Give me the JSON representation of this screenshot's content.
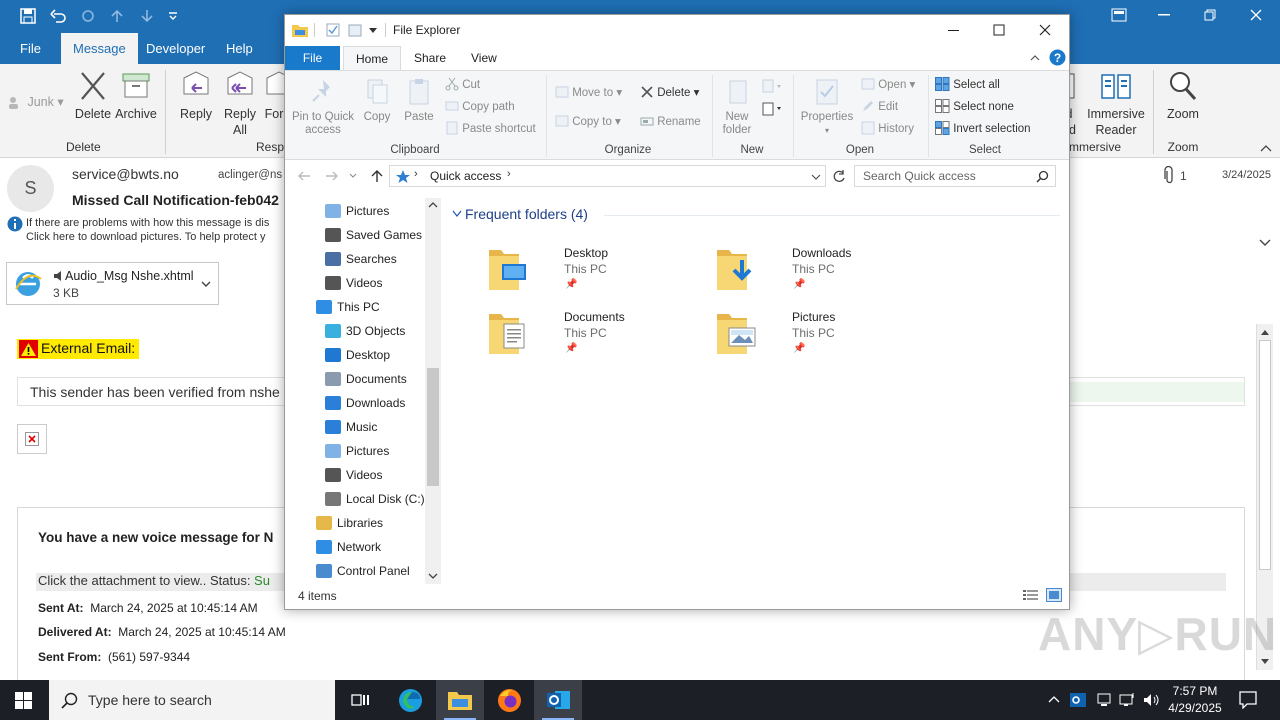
{
  "outlook": {
    "title_text": "",
    "tabs": [
      "File",
      "Message",
      "Developer",
      "Help"
    ],
    "ribbon": {
      "junk": "Junk",
      "delete": "Delete",
      "archive": "Archive",
      "group_delete": "Delete",
      "reply": "Reply",
      "reply_all_1": "Reply",
      "reply_all_2": "All",
      "forward": "For",
      "group_respond": "Resp",
      "read_aloud_1": "d",
      "read_aloud_2": "ud",
      "immersive_1": "Immersive",
      "immersive_2": "Reader",
      "group_immersive": "mmersive",
      "zoom": "Zoom",
      "group_zoom": "Zoom"
    },
    "message": {
      "avatar_letter": "S",
      "from": "service@bwts.no",
      "to": "aclinger@ns",
      "subject": "Missed Call Notification-feb042",
      "info_line1": "If there are problems with how this message is dis",
      "info_line2": "Click here to download pictures. To help protect y",
      "attachment_count": "1",
      "date": "3/24/2025",
      "attachment_name": "Audio_Msg Nshe.xhtml",
      "attachment_size": "3 KB",
      "external_label": "External Email:",
      "verified_text": "This sender has been verified from nshe",
      "voice_heading": "You have a new voice message for N",
      "click_line": "Click the attachment to view.. Status: ",
      "status_value": "Su",
      "sent_at_label": "Sent At:",
      "sent_at_value": "March 24, 2025 at 10:45:14 AM",
      "delivered_label": "Delivered At:",
      "delivered_value": "March 24, 2025 at 10:45:14 AM",
      "sent_from_label": "Sent From:",
      "sent_from_value": "(561) 597-9344"
    }
  },
  "explorer": {
    "title": "File Explorer",
    "tabs": [
      "File",
      "Home",
      "Share",
      "View"
    ],
    "ribbon": {
      "pin_1": "Pin to Quick",
      "pin_2": "access",
      "copy": "Copy",
      "paste": "Paste",
      "cut": "Cut",
      "copy_path": "Copy path",
      "paste_shortcut": "Paste shortcut",
      "group_clipboard": "Clipboard",
      "move_to": "Move to",
      "copy_to": "Copy to",
      "delete": "Delete",
      "rename": "Rename",
      "group_organize": "Organize",
      "new_folder_1": "New",
      "new_folder_2": "folder",
      "group_new": "New",
      "properties": "Properties",
      "open": "Open",
      "edit": "Edit",
      "history": "History",
      "group_open": "Open",
      "select_all": "Select all",
      "select_none": "Select none",
      "invert_selection": "Invert selection",
      "group_select": "Select"
    },
    "address": "Quick access",
    "search_placeholder": "Search Quick access",
    "nav": [
      {
        "label": "Pictures",
        "icon": "pictures-icon"
      },
      {
        "label": "Saved Games",
        "icon": "saved-games-icon"
      },
      {
        "label": "Searches",
        "icon": "searches-icon"
      },
      {
        "label": "Videos",
        "icon": "videos-icon"
      },
      {
        "label": "This PC",
        "icon": "this-pc-icon"
      },
      {
        "label": "3D Objects",
        "icon": "3d-objects-icon"
      },
      {
        "label": "Desktop",
        "icon": "desktop-icon"
      },
      {
        "label": "Documents",
        "icon": "documents-icon"
      },
      {
        "label": "Downloads",
        "icon": "downloads-icon"
      },
      {
        "label": "Music",
        "icon": "music-icon"
      },
      {
        "label": "Pictures",
        "icon": "pictures-icon"
      },
      {
        "label": "Videos",
        "icon": "videos-icon"
      },
      {
        "label": "Local Disk (C:)",
        "icon": "local-disk-icon"
      },
      {
        "label": "Libraries",
        "icon": "libraries-icon"
      },
      {
        "label": "Network",
        "icon": "network-icon"
      },
      {
        "label": "Control Panel",
        "icon": "control-panel-icon"
      }
    ],
    "section_title": "Frequent folders (4)",
    "folders": [
      {
        "name": "Desktop",
        "location": "This PC"
      },
      {
        "name": "Downloads",
        "location": "This PC"
      },
      {
        "name": "Documents",
        "location": "This PC"
      },
      {
        "name": "Pictures",
        "location": "This PC"
      }
    ],
    "status": "4 items"
  },
  "taskbar": {
    "search_placeholder": "Type here to search",
    "time": "7:57 PM",
    "date": "4/29/2025"
  },
  "watermark": "ANY RUN",
  "colors": {
    "accent": "#1f6fb5",
    "explorer_file_tab": "#1979ca",
    "warning_yellow": "#ffea00",
    "taskbar": "#1c1f26"
  }
}
